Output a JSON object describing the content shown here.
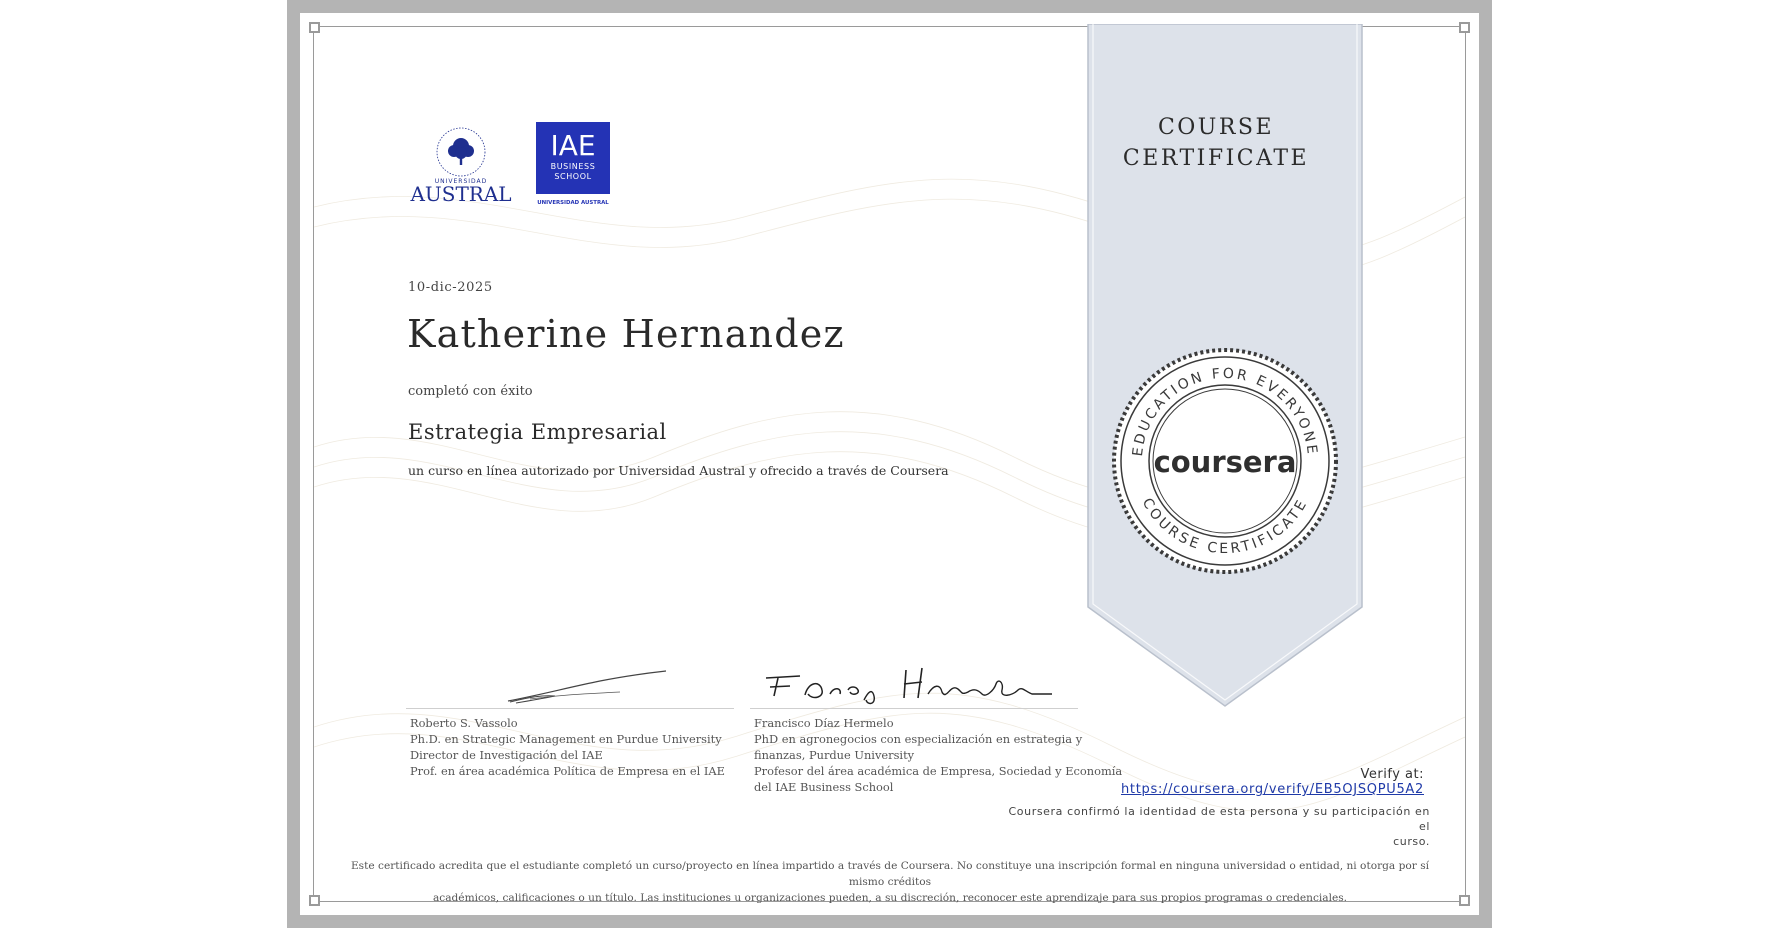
{
  "ribbon": {
    "title_line1": "COURSE",
    "title_line2": "CERTIFICATE"
  },
  "seal": {
    "top_text": "EDUCATION FOR EVERYONE",
    "bottom_text": "COURSE CERTIFICATE",
    "brand": "coursera"
  },
  "logos": {
    "austral": {
      "small": "UNIVERSIDAD",
      "big": "AUSTRAL"
    },
    "iae": {
      "big": "IAE",
      "line1": "BUSINESS",
      "line2": "SCHOOL",
      "footer": "UNIVERSIDAD AUSTRAL"
    }
  },
  "certificate": {
    "date": "10-dic-2025",
    "recipient": "Katherine Hernandez",
    "completed": "completó con éxito",
    "course": "Estrategia Empresarial",
    "description": "un curso en línea autorizado por Universidad Austral y ofrecido a través de Coursera"
  },
  "signers": [
    {
      "lines": [
        "Roberto S. Vassolo",
        "Ph.D. en Strategic Management en Purdue University",
        "Director de Investigación del IAE",
        "Prof. en área académica Política de Empresa en el IAE"
      ]
    },
    {
      "lines": [
        "Francisco Díaz Hermelo",
        "PhD en agronegocios con especialización en estrategia y",
        "finanzas, Purdue University",
        "Profesor del área académica de Empresa, Sociedad y Economía",
        "del IAE Business School"
      ]
    }
  ],
  "verify": {
    "label": "Verify at:",
    "url": "https://coursera.org/verify/EB5OJSQPU5A2",
    "note_line1": "Coursera confirmó la identidad de esta persona y su participación en el",
    "note_line2": "curso."
  },
  "disclaimer": {
    "line1": "Este certificado acredita que el estudiante completó un curso/proyecto en línea impartido a través de Coursera. No constituye una inscripción formal en ninguna universidad o entidad, ni otorga por sí mismo créditos",
    "line2": "académicos, calificaciones o un título. Las instituciones u organizaciones pueden, a su discreción, reconocer este aprendizaje para sus propios programas o credenciales."
  },
  "colors": {
    "frame": "#b4b4b4",
    "ribbon": "#dde2ea",
    "iae_blue": "#2433b5",
    "austral_blue": "#1f2f8f",
    "link": "#1f3aa8"
  }
}
